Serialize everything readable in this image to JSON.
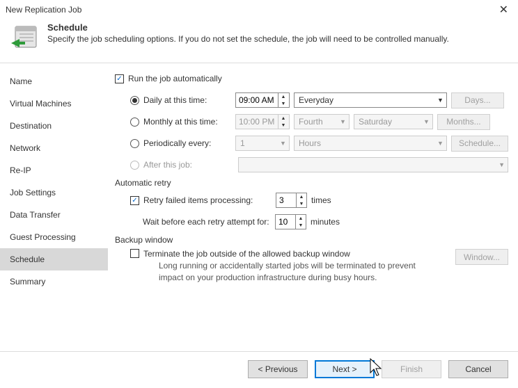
{
  "window": {
    "title": "New Replication Job"
  },
  "header": {
    "title": "Schedule",
    "subtitle": "Specify the job scheduling options. If you do not set the schedule, the job will need to be controlled manually."
  },
  "sidebar": {
    "items": [
      {
        "label": "Name"
      },
      {
        "label": "Virtual Machines"
      },
      {
        "label": "Destination"
      },
      {
        "label": "Network"
      },
      {
        "label": "Re-IP"
      },
      {
        "label": "Job Settings"
      },
      {
        "label": "Data Transfer"
      },
      {
        "label": "Guest Processing"
      },
      {
        "label": "Schedule"
      },
      {
        "label": "Summary"
      }
    ],
    "active_index": 8
  },
  "schedule": {
    "run_auto_label": "Run the job automatically",
    "daily_label": "Daily at this time:",
    "daily_time_h": "09",
    "daily_time_m": "00",
    "daily_time_ampm": "AM",
    "daily_every": "Everyday",
    "days_btn": "Days...",
    "monthly_label": "Monthly at this time:",
    "monthly_time": "10:00 PM",
    "monthly_ord": "Fourth",
    "monthly_day": "Saturday",
    "months_btn": "Months...",
    "periodic_label": "Periodically every:",
    "periodic_n": "1",
    "periodic_unit": "Hours",
    "schedule_btn": "Schedule...",
    "after_label": "After this job:"
  },
  "retry": {
    "section": "Automatic retry",
    "retry_label": "Retry failed items processing:",
    "retry_n": "3",
    "retry_times": "times",
    "wait_label": "Wait before each retry attempt for:",
    "wait_n": "10",
    "wait_min": "minutes"
  },
  "window_section": {
    "section": "Backup window",
    "terminate_label": "Terminate the job outside of the allowed backup window",
    "window_btn": "Window...",
    "note": "Long running or accidentally started jobs will be terminated to prevent impact on your production infrastructure during busy hours."
  },
  "footer": {
    "previous": "< Previous",
    "next": "Next >",
    "finish": "Finish",
    "cancel": "Cancel"
  }
}
